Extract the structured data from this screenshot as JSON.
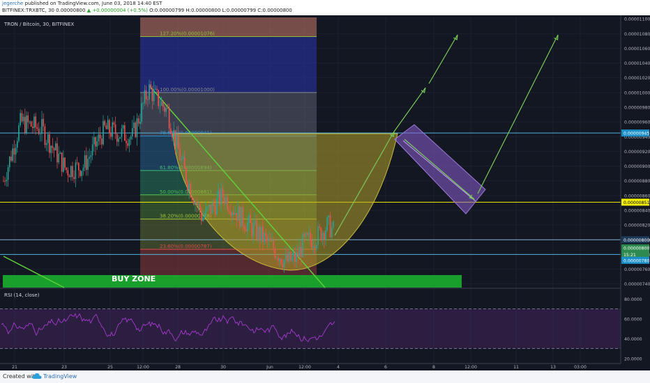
{
  "header": {
    "author": "jegerche",
    "published_text": "published on TradingView.com, June 03, 2018 14:40 EST",
    "symbol": "BITFINEX:TRXBTC, 30",
    "last_price": "0.00000800",
    "change": "+0.00000004 (+0.5%)",
    "ohlc_text": "O:0.00000799 H:0.00000800 L:0.00000799 C:0.00000800"
  },
  "footer": {
    "created_with": "Created with",
    "brand": "TradingView"
  },
  "chart_data": {
    "type": "candlestick",
    "title": "TRON / Bitcoin, 30, BITFINEX",
    "x_ticks": [
      "21",
      "23",
      "25",
      "12:00",
      "28",
      "30",
      "Jun",
      "12:00",
      "4",
      "6",
      "8",
      "12:00",
      "11",
      "13",
      "03:00"
    ],
    "price_axis": {
      "ticks": [
        "0.00001100",
        "0.00001080",
        "0.00001060",
        "0.00001040",
        "0.00001020",
        "0.00001000",
        "0.00000980",
        "0.00000960",
        "0.00000940",
        "0.00000920",
        "0.00000900",
        "0.00000880",
        "0.00000860",
        "0.00000840",
        "0.00000820",
        "0.00000800",
        "0.00000780",
        "0.00000760",
        "0.00000740"
      ],
      "range": [
        7.35e-06,
        1.102e-05
      ],
      "price_labels": [
        {
          "text": "0.00000945",
          "value": 9.45e-06,
          "color": "#ffffff",
          "bg": "#1a8fc9"
        },
        {
          "text": "0.00000851",
          "value": 8.51e-06,
          "color": "#000000",
          "bg": "#f4f000"
        },
        {
          "text": "0.00000800",
          "value": 8e-06,
          "color": "#ffffff",
          "bg": "#1e3a59"
        },
        {
          "text": "0.00000800",
          "value": 7.89e-06,
          "color": "#ffffff",
          "bg": "#2e8b4f"
        },
        {
          "text": "15:21",
          "value": 7.8e-06,
          "color": "#ffffff",
          "bg": "#2e8b4f"
        },
        {
          "text": "0.00000780",
          "value": 7.72e-06,
          "color": "#ffffff",
          "bg": "#1a8fc9"
        }
      ]
    },
    "fibonacci": {
      "levels": [
        {
          "text": "127.20%(0.00001076)",
          "value": 1.076e-05,
          "color": "#8fbf3a"
        },
        {
          "text": "100.00%(0.00001000)",
          "value": 1e-05,
          "color": "#8a8a8a"
        },
        {
          "text": "78.60%(0.00000941)",
          "value": 9.41e-06,
          "color": "#2a8fc9"
        },
        {
          "text": "61.80%(0.00000894)",
          "value": 8.94e-06,
          "color": "#3fc07a"
        },
        {
          "text": "50.00%(0.00000861)",
          "value": 8.61e-06,
          "color": "#4fc04f"
        },
        {
          "text": "38.20%(0.00000828)",
          "value": 8.28e-06,
          "color": "#a5c43a"
        },
        {
          "text": "23.60%(0.00000787)",
          "value": 7.87e-06,
          "color": "#e04a4a"
        }
      ]
    },
    "horizontal_lines": [
      {
        "value": 9.45e-06,
        "color": "#4fb6e0"
      },
      {
        "value": 8.51e-06,
        "color": "#f4f000"
      },
      {
        "value": 8e-06,
        "color": "#7fb0d0"
      },
      {
        "value": 7.8e-06,
        "color": "#4fb6e0"
      }
    ],
    "annotations": [
      {
        "text": "BUY ZONE",
        "color": "#ffffff"
      }
    ],
    "rsi": {
      "title": "RSI (14, close)",
      "ticks": [
        "80.0000",
        "60.0000",
        "40.0000",
        "20.0000"
      ],
      "range": [
        15,
        90
      ],
      "upper_band": 70,
      "lower_band": 30,
      "color": "#a83ad0"
    },
    "colors": {
      "up": "#26a69a",
      "down": "#ef5350",
      "background": "#131722",
      "cup_fill": "#b5a02a",
      "channel_fill": "#8a5fd0",
      "trendline": "#5fd03a"
    }
  }
}
